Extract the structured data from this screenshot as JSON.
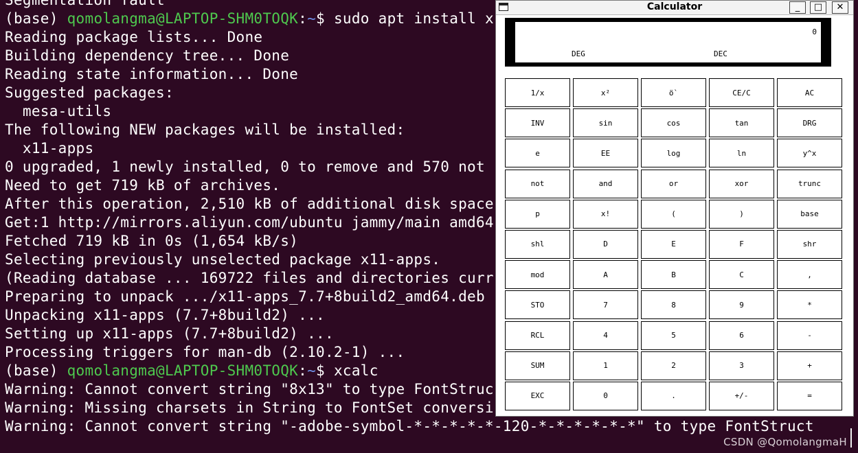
{
  "terminal": {
    "lines": [
      {
        "text": "Segmentation fault"
      },
      {
        "prompt": {
          "env": "(base) ",
          "user": "qomolangma@LAPTOP-SHM0TOQK",
          "sep": ":",
          "path": "~",
          "dollar": "$ "
        },
        "text": "sudo apt install x"
      },
      {
        "text": "Reading package lists... Done"
      },
      {
        "text": "Building dependency tree... Done"
      },
      {
        "text": "Reading state information... Done"
      },
      {
        "text": "Suggested packages:"
      },
      {
        "text": "  mesa-utils"
      },
      {
        "text": "The following NEW packages will be installed:"
      },
      {
        "text": "  x11-apps"
      },
      {
        "text": "0 upgraded, 1 newly installed, 0 to remove and 570 not"
      },
      {
        "text": "Need to get 719 kB of archives."
      },
      {
        "text": "After this operation, 2,510 kB of additional disk space"
      },
      {
        "text": "Get:1 http://mirrors.aliyun.com/ubuntu jammy/main amd64"
      },
      {
        "text": "Fetched 719 kB in 0s (1,654 kB/s)"
      },
      {
        "text": "Selecting previously unselected package x11-apps."
      },
      {
        "text": "(Reading database ... 169722 files and directories curr"
      },
      {
        "text": "Preparing to unpack .../x11-apps_7.7+8build2_amd64.deb"
      },
      {
        "text": "Unpacking x11-apps (7.7+8build2) ..."
      },
      {
        "text": "Setting up x11-apps (7.7+8build2) ..."
      },
      {
        "text": "Processing triggers for man-db (2.10.2-1) ..."
      },
      {
        "prompt": {
          "env": "(base) ",
          "user": "qomolangma@LAPTOP-SHM0TOQK",
          "sep": ":",
          "path": "~",
          "dollar": "$ "
        },
        "text": "xcalc"
      },
      {
        "text": "Warning: Cannot convert string \"8x13\" to type FontStruc"
      },
      {
        "text": "Warning: Missing charsets in String to FontSet conversi"
      },
      {
        "text": "Warning: Cannot convert string \"-adobe-symbol-*-*-*-*-*-120-*-*-*-*-*-*\" to type FontStruct"
      }
    ],
    "watermark": "CSDN @QomolangmaH",
    "colors": {
      "background": "#2d0922",
      "user": "#4ec94e",
      "path": "#6f8fe8"
    }
  },
  "calculator": {
    "title": "Calculator",
    "window_controls": {
      "minimize": "_",
      "maximize": "□",
      "close": "✕"
    },
    "display": {
      "value": "0",
      "angle_mode": "DEG",
      "base_mode": "DEC"
    },
    "keys": [
      "1/x",
      "x²",
      "ö`",
      "CE/C",
      "AC",
      "INV",
      "sin",
      "cos",
      "tan",
      "DRG",
      "e",
      "EE",
      "log",
      "ln",
      "y^x",
      "not",
      "and",
      "or",
      "xor",
      "trunc",
      "p",
      "x!",
      "(",
      ")",
      "base",
      "shl",
      "D",
      "E",
      "F",
      "shr",
      "mod",
      "A",
      "B",
      "C",
      ",",
      "STO",
      "7",
      "8",
      "9",
      "*",
      "RCL",
      "4",
      "5",
      "6",
      "-",
      "SUM",
      "1",
      "2",
      "3",
      "+",
      "EXC",
      "0",
      ".",
      "+/-",
      "="
    ]
  }
}
